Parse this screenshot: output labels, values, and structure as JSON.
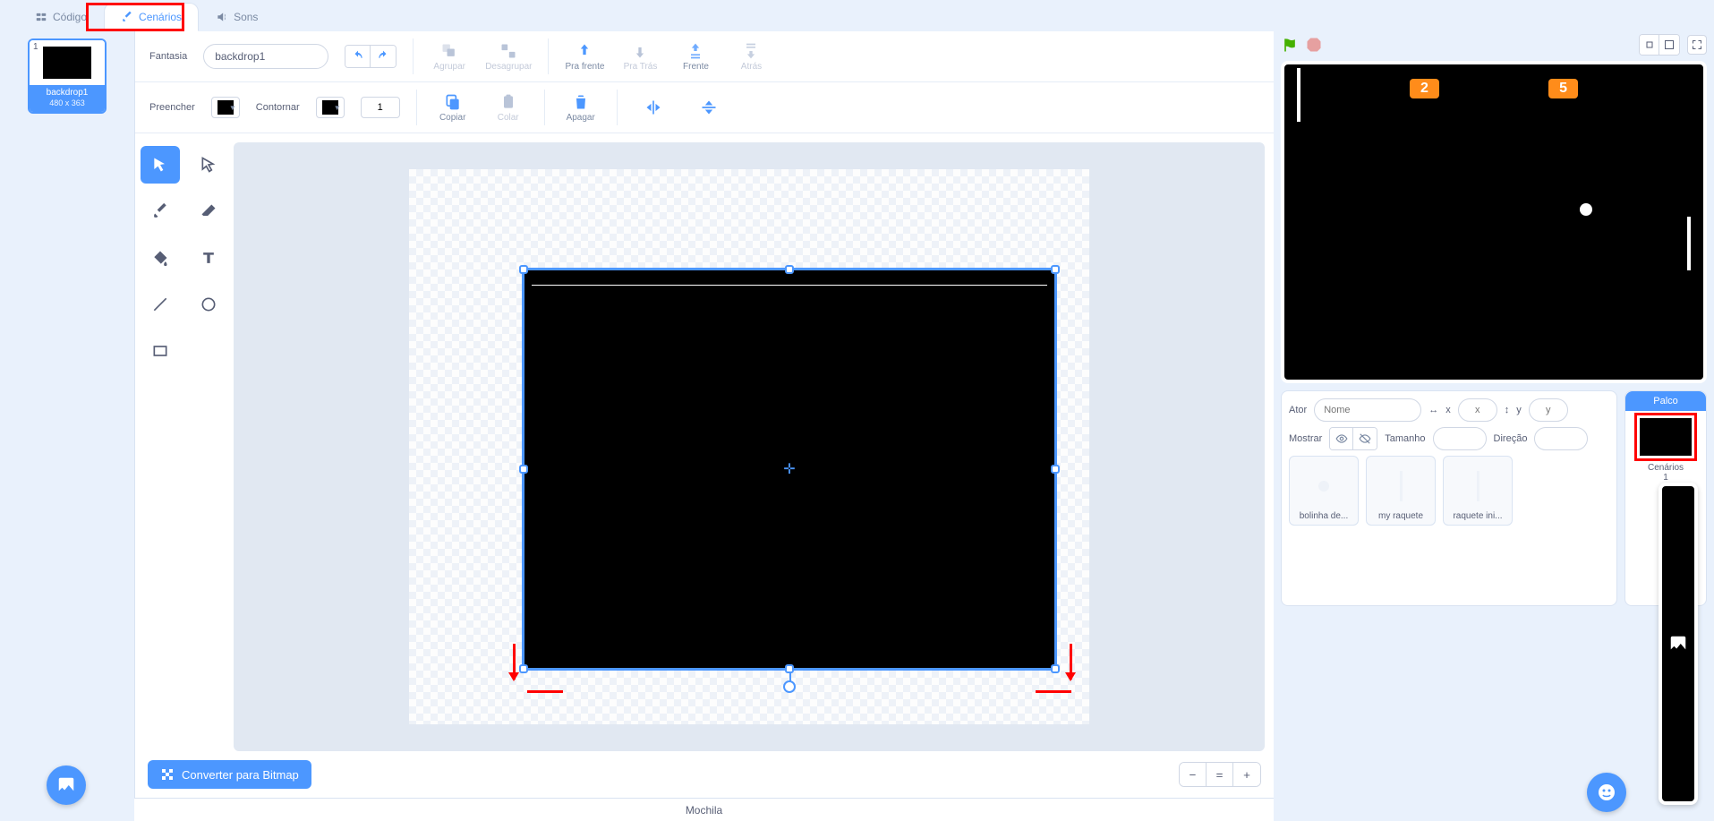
{
  "tabs": {
    "code": "Código",
    "costumes": "Cenários",
    "sounds": "Sons"
  },
  "costume_list": {
    "selected": {
      "index": "1",
      "name": "backdrop1",
      "dimensions": "480 x 363"
    }
  },
  "editor_toolbar": {
    "costume_label": "Fantasia",
    "costume_name": "backdrop1",
    "group": "Agrupar",
    "ungroup": "Desagrupar",
    "forward": "Pra frente",
    "backward": "Pra Trás",
    "front": "Frente",
    "back": "Atrás",
    "fill_label": "Preencher",
    "outline_label": "Contornar",
    "outline_width": "1",
    "copy": "Copiar",
    "paste": "Colar",
    "delete": "Apagar"
  },
  "bottom": {
    "convert": "Converter para Bitmap",
    "mochila": "Mochila"
  },
  "stage": {
    "score_left": "2",
    "score_right": "5"
  },
  "sprite_info": {
    "ator_label": "Ator",
    "name_placeholder": "Nome",
    "x_label": "x",
    "y_label": "y",
    "mostrar_label": "Mostrar",
    "tamanho_label": "Tamanho",
    "direcao_label": "Direção"
  },
  "sprites": {
    "s1": "bolinha de...",
    "s2": "my raquete",
    "s3": "raquete ini..."
  },
  "stage_panel": {
    "title": "Palco",
    "label": "Cenários",
    "count": "1"
  }
}
